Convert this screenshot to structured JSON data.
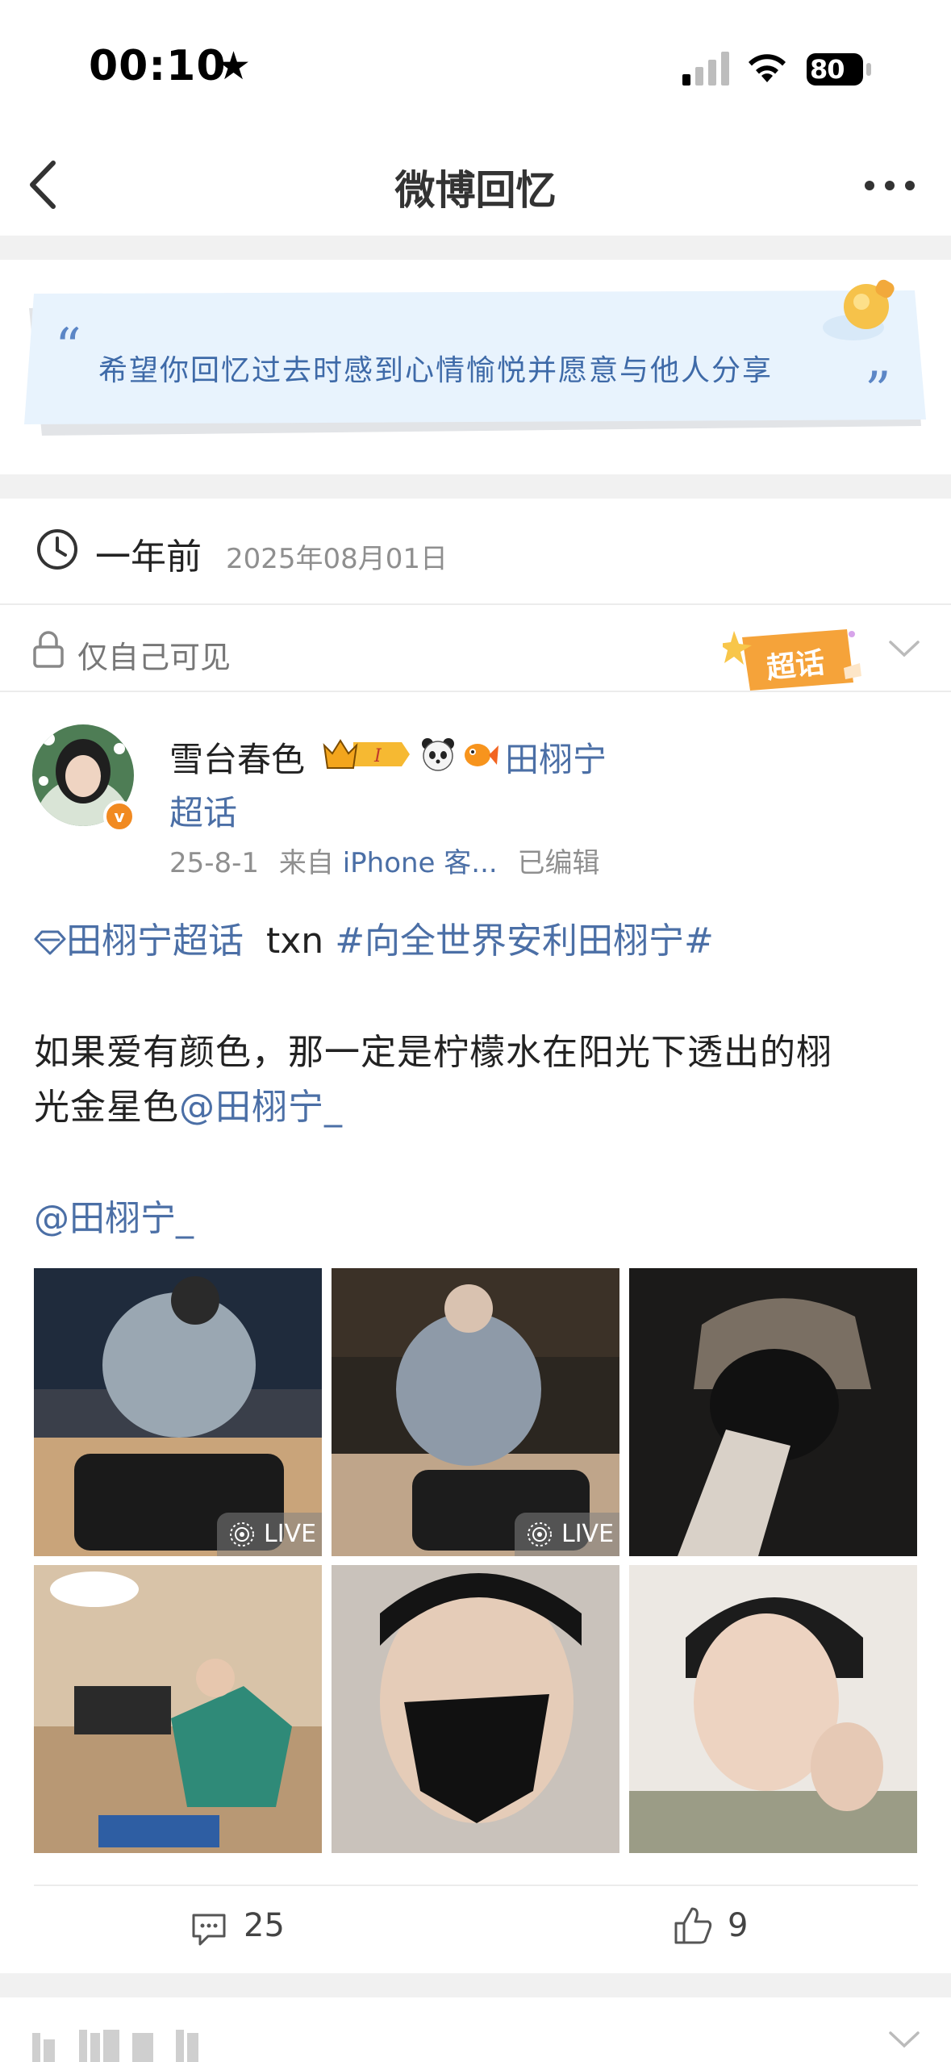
{
  "status_bar": {
    "time": "00:10",
    "battery": "80"
  },
  "nav": {
    "title": "微博回忆"
  },
  "quote": {
    "text": "希望你回忆过去时感到心情愉悦并愿意与他人分享",
    "open_mark": "“",
    "close_mark": "”"
  },
  "memory": {
    "relative_time": "一年前",
    "date": "2025年08月01日"
  },
  "privacy": {
    "label": "仅自己可见",
    "badge": "超话"
  },
  "post": {
    "username": "雪台春色",
    "mention_name": "田栩宁",
    "supertopic_link": "超话",
    "meta": {
      "date": "25-8-1",
      "from_label": "来自",
      "source": "iPhone 客...",
      "edited": "已编辑"
    },
    "topic_supertopic": "田栩宁超话",
    "topic_plain": "txn",
    "topic_hashtag": "#向全世界安利田栩宁#",
    "body_line1": "如果爱有颜色，那一定是柠檬水在阳光下透出的栩",
    "body_line2_text": "光金星色",
    "body_line2_mention": "@田栩宁_",
    "mention_line": "@田栩宁_",
    "images": [
      {
        "live": true,
        "live_label": "LIVE"
      },
      {
        "live": true,
        "live_label": "LIVE"
      },
      {
        "live": false
      },
      {
        "live": false
      },
      {
        "live": false
      },
      {
        "live": false
      }
    ]
  },
  "actions": {
    "comments": "25",
    "likes": "9"
  },
  "colors": {
    "link_blue": "#4b6fa6",
    "quote_blue": "#3e6aa8",
    "badge_orange": "#f5a33a",
    "divider": "#f1f1f1"
  }
}
